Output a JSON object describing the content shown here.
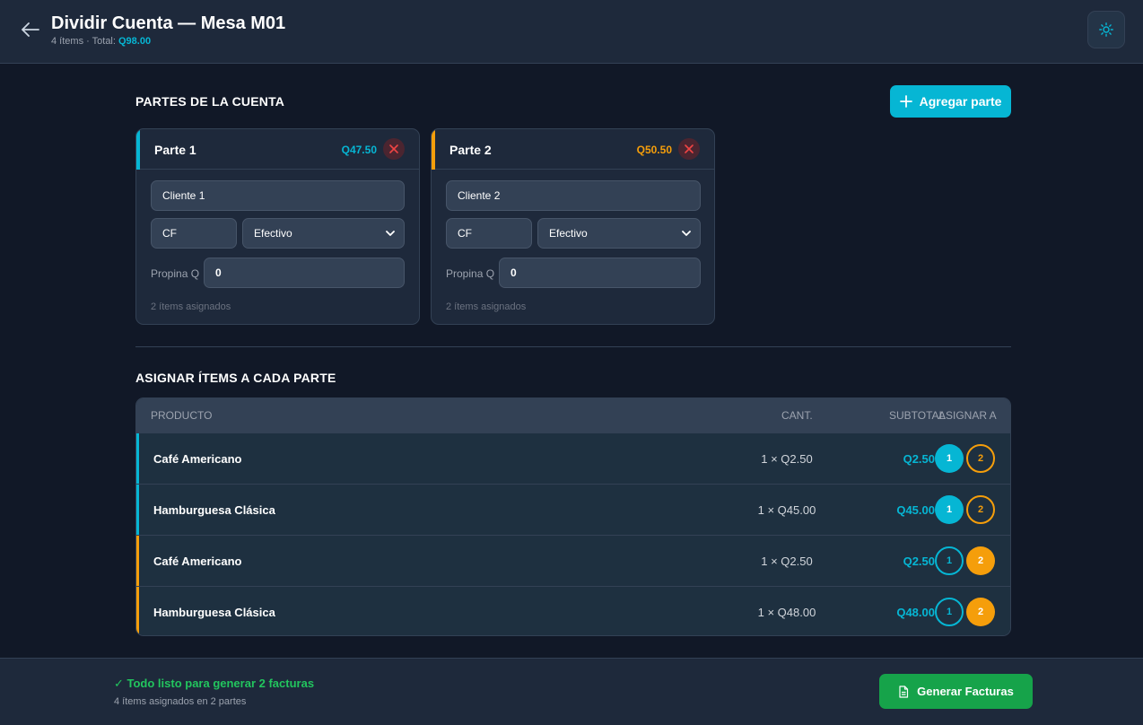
{
  "header": {
    "title": "Dividir Cuenta — Mesa M01",
    "items_count": "4 ítems · Total:",
    "total": "Q98.00"
  },
  "parts_section": {
    "title": "PARTES DE LA CUENTA",
    "add_label": "Agregar parte"
  },
  "parts": [
    {
      "name": "Parte 1",
      "total": "Q47.50",
      "color": "#06b6d4",
      "client": "Cliente 1",
      "nit": "CF",
      "payment": "Efectivo",
      "tip_label": "Propina Q",
      "tip": "0",
      "assigned": "2 ítems asignados"
    },
    {
      "name": "Parte 2",
      "total": "Q50.50",
      "color": "#f59e0b",
      "client": "Cliente 2",
      "nit": "CF",
      "payment": "Efectivo",
      "tip_label": "Propina Q",
      "tip": "0",
      "assigned": "2 ítems asignados"
    }
  ],
  "items_section": {
    "title": "ASIGNAR ÍTEMS A CADA PARTE",
    "headers": {
      "product": "PRODUCTO",
      "qty": "CANT.",
      "subtotal": "SUBTOTAL",
      "assign": "ASIGNAR A"
    }
  },
  "items": [
    {
      "product": "Café Americano",
      "qty": "1 × Q2.50",
      "subtotal": "Q2.50",
      "assigned_part": 1,
      "accent": "#06b6d4"
    },
    {
      "product": "Hamburguesa Clásica",
      "qty": "1 × Q45.00",
      "subtotal": "Q45.00",
      "assigned_part": 1,
      "accent": "#06b6d4"
    },
    {
      "product": "Café Americano",
      "qty": "1 × Q2.50",
      "subtotal": "Q2.50",
      "assigned_part": 2,
      "accent": "#f59e0b"
    },
    {
      "product": "Hamburguesa Clásica",
      "qty": "1 × Q48.00",
      "subtotal": "Q48.00",
      "assigned_part": 2,
      "accent": "#f59e0b"
    }
  ],
  "part_buttons": [
    "1",
    "2"
  ],
  "footer": {
    "ready": "✓ Todo listo para generar 2 facturas",
    "summary": "4 ítems asignados en 2 partes",
    "generate_label": "Generar Facturas"
  },
  "icons": {
    "back": "arrow-left-icon",
    "theme": "sun-icon",
    "add": "plus-icon",
    "remove": "close-icon",
    "select": "chevron-down-icon",
    "generate": "document-icon"
  }
}
